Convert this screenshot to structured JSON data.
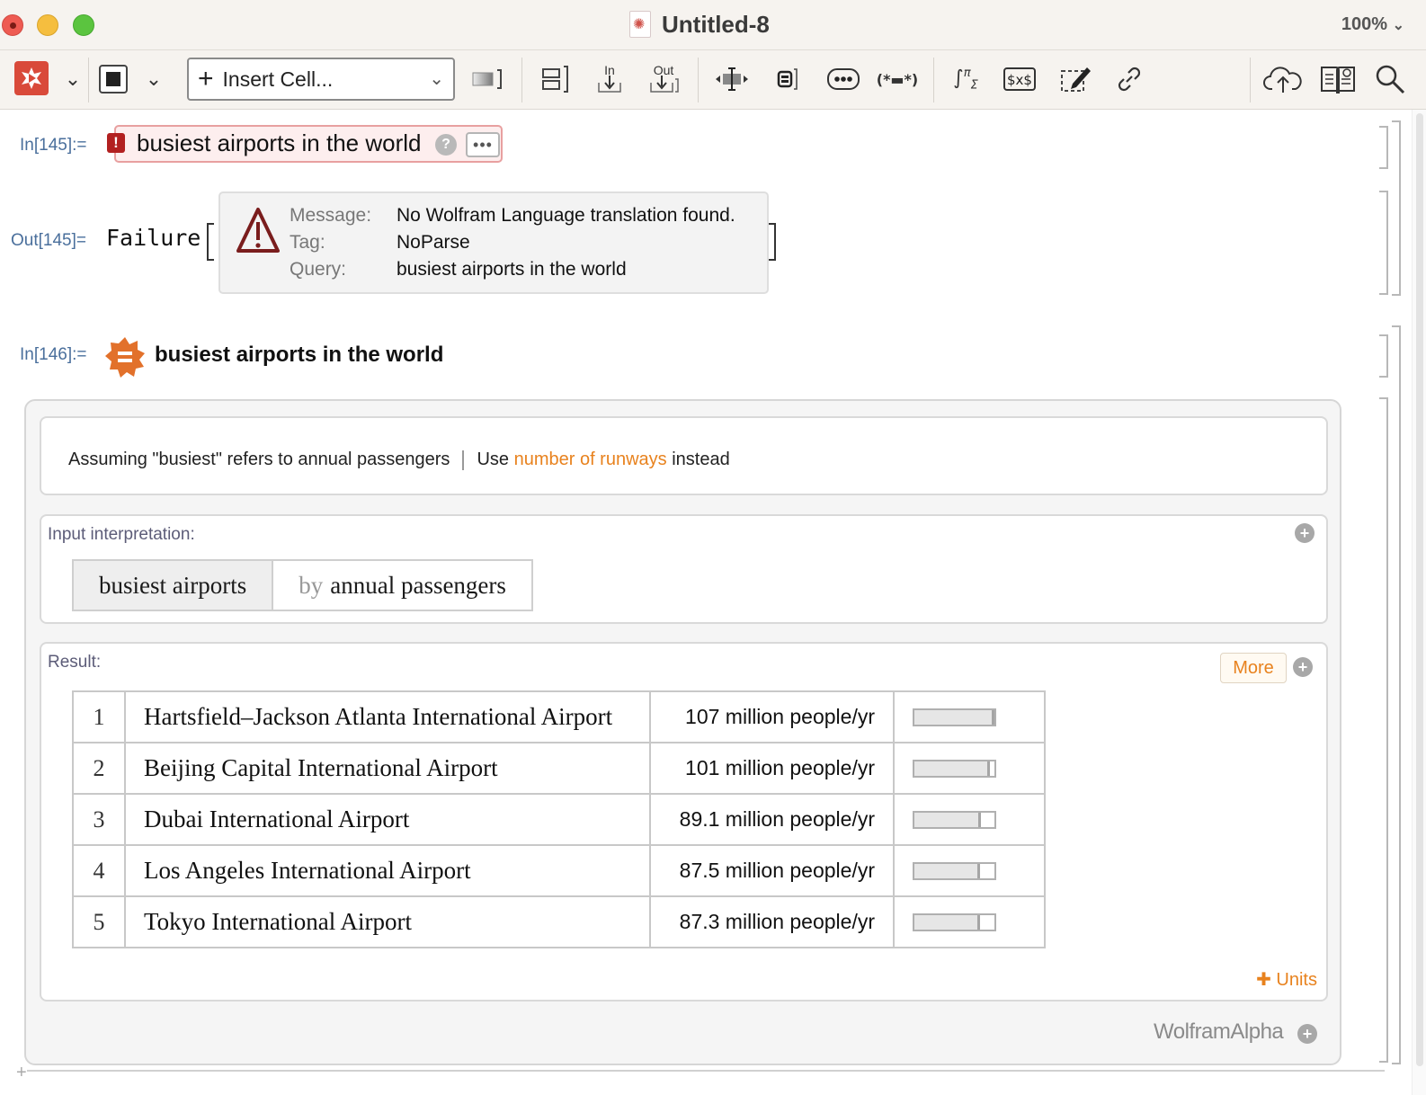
{
  "window": {
    "title": "Untitled-8",
    "zoom": "100%"
  },
  "toolbar": {
    "insert_cell_label": "Insert Cell...",
    "in_label": "In",
    "out_label": "Out"
  },
  "cells": {
    "in145": {
      "label": "In[145]:=",
      "query": "busiest airports in the world"
    },
    "out145": {
      "label": "Out[145]=",
      "head": "Failure",
      "message_key": "Message:",
      "message_val": "No Wolfram Language translation found.",
      "tag_key": "Tag:",
      "tag_val": "NoParse",
      "query_key": "Query:",
      "query_val": "busiest airports in the world"
    },
    "in146": {
      "label": "In[146]:=",
      "query": "busiest airports in the world"
    }
  },
  "wolframalpha": {
    "assumption": {
      "text": "Assuming \"busiest\" refers to annual passengers",
      "use_prefix": "Use",
      "link": "number of runways",
      "suffix": "instead"
    },
    "input_interpretation": {
      "title": "Input interpretation:",
      "primary": "busiest airports",
      "by": "by",
      "secondary": "annual passengers"
    },
    "result": {
      "title": "Result:",
      "more_label": "More",
      "units_label": "Units",
      "rows": [
        {
          "rank": "1",
          "name": "Hartsfield–Jackson Atlanta International Airport",
          "value": "107 million people/yr",
          "fraction": 1.0
        },
        {
          "rank": "2",
          "name": "Beijing Capital International Airport",
          "value": "101 million people/yr",
          "fraction": 0.944
        },
        {
          "rank": "3",
          "name": "Dubai International Airport",
          "value": "89.1 million people/yr",
          "fraction": 0.833
        },
        {
          "rank": "4",
          "name": "Los Angeles International Airport",
          "value": "87.5 million people/yr",
          "fraction": 0.818
        },
        {
          "rank": "5",
          "name": "Tokyo International Airport",
          "value": "87.3 million people/yr",
          "fraction": 0.816
        }
      ]
    },
    "brand": "WolframAlpha"
  },
  "colors": {
    "accent_orange": "#e8821e",
    "error_red": "#b22020",
    "cell_label_blue": "#4a6f9c"
  }
}
